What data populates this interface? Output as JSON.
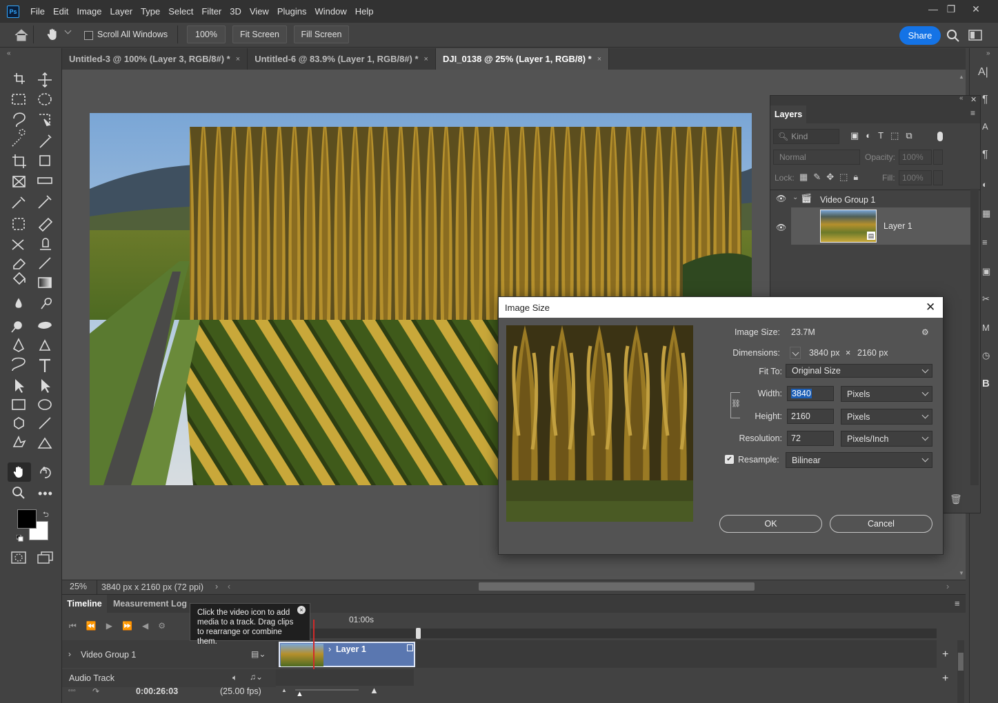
{
  "app": {
    "logo": "Ps"
  },
  "menu": [
    "File",
    "Edit",
    "Image",
    "Layer",
    "Type",
    "Select",
    "Filter",
    "3D",
    "View",
    "Plugins",
    "Window",
    "Help"
  ],
  "options": {
    "scroll_all_windows": "Scroll All Windows",
    "zoom_100": "100%",
    "fit_screen": "Fit Screen",
    "fill_screen": "Fill Screen",
    "share": "Share"
  },
  "tabs": [
    {
      "label": "Untitled-3 @ 100% (Layer 3, RGB/8#) *"
    },
    {
      "label": "Untitled-6 @ 83.9% (Layer 1, RGB/8#) *"
    },
    {
      "label": "DJI_0138 @ 25% (Layer 1, RGB/8) *"
    }
  ],
  "status": {
    "zoom": "25%",
    "doc_info": "3840 px x 2160 px (72 ppi)"
  },
  "layers_panel": {
    "title": "Layers",
    "kind_placeholder": "Kind",
    "blend_mode": "Normal",
    "opacity_label": "Opacity:",
    "opacity_value": "100%",
    "lock_label": "Lock:",
    "fill_label": "Fill:",
    "fill_value": "100%",
    "group_name": "Video Group 1",
    "layer_name": "Layer 1"
  },
  "dialog": {
    "title": "Image Size",
    "image_size_label": "Image Size:",
    "image_size_value": "23.7M",
    "dimensions_label": "Dimensions:",
    "dim_w": "3840 px",
    "dim_x": "×",
    "dim_h": "2160 px",
    "fit_to_label": "Fit To:",
    "fit_to_value": "Original Size",
    "width_label": "Width:",
    "width_value": "3840",
    "width_unit": "Pixels",
    "height_label": "Height:",
    "height_value": "2160",
    "height_unit": "Pixels",
    "resolution_label": "Resolution:",
    "resolution_value": "72",
    "resolution_unit": "Pixels/Inch",
    "resample_label": "Resample:",
    "resample_value": "Bilinear",
    "ok": "OK",
    "cancel": "Cancel"
  },
  "timeline": {
    "tab_timeline": "Timeline",
    "tab_measurement": "Measurement Log",
    "tooltip": "Click the video icon to add media to a track. Drag clips to rearrange or combine them.",
    "time_marker": "01:00s",
    "video_group": "Video Group 1",
    "clip_label": "Layer 1",
    "audio_track": "Audio Track",
    "timecode": "0:00:26:03",
    "fps": "(25.00 fps)"
  },
  "colors": {
    "accent": "#1473e6",
    "foreground": "#000000",
    "background": "#ffffff",
    "clip": "#5a77b0"
  }
}
